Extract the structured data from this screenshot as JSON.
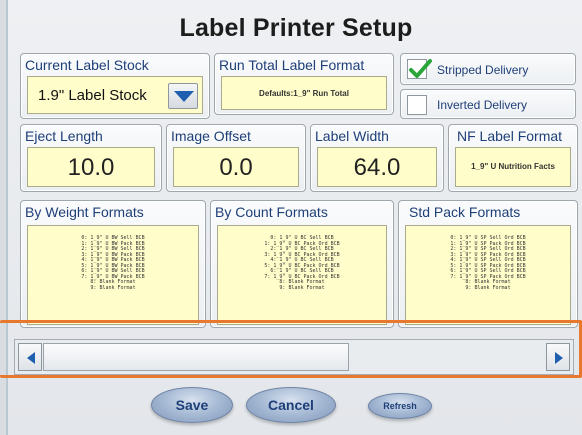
{
  "title": "Label Printer Setup",
  "current_label_stock": {
    "title": "Current Label Stock",
    "value": "1.9\" Label Stock"
  },
  "run_total": {
    "title": "Run Total Label Format",
    "value": "Defaults:1_9\" Run Total"
  },
  "options": {
    "stripped": {
      "label": "Stripped Delivery",
      "checked": true
    },
    "inverted": {
      "label": "Inverted Delivery",
      "checked": false
    }
  },
  "eject_length": {
    "title": "Eject Length",
    "value": "10.0"
  },
  "image_offset": {
    "title": "Image Offset",
    "value": "0.0"
  },
  "label_width": {
    "title": "Label Width",
    "value": "64.0"
  },
  "nf_label_format": {
    "title": "NF Label Format",
    "value": "1_9\" U Nutrition Facts"
  },
  "by_weight": {
    "title": "By Weight Formats",
    "items": "0: 1_9\" U BW Sell BCB\n1: 1_9\" U BW Pack BCB\n2: 1_9\" U BW Sell BCB\n3: 1_9\" U BW Pack BCB\n4: 1_9\" U BW Pack BCB\n5: 1_9\" U BW Pack BCB\n6: 1_9\" U BW Sell BCB\n7: 1_9\" U BW Pack BCB\n8: Blank Format\n9: Blank Format"
  },
  "by_count": {
    "title": "By Count Formats",
    "items": "0: 1_9\" U BC Sell BCB\n1: 1_9\" U BC Pack Ord BCB\n2: 1_9\" U BC Sell BCB\n3: 1_9\" U BC Pack Ord BCB\n4: 1_9\" U BC Sell BCB\n5: 1_9\" U BC Pack Ord BCB\n6: 1_9\" U BC Sell BCB\n7: 1_9\" U BC Pack Ord BCB\n8: Blank Format\n9: Blank Format"
  },
  "std_pack": {
    "title": "Std Pack Formats",
    "items": "0: 1_9\" U SP Sell Ord BCB\n1: 1_9\" U SP Pack Ord BCB\n2: 1_9\" U SP Sell Ord BCB\n3: 1_9\" U SP Pack Ord BCB\n4: 1_9\" U SP Sell Ord BCB\n5: 1_9\" U SP Pack Ord BCB\n6: 1_9\" U SP Sell Ord BCB\n7: 1_9\" U SP Pack Ord BCB\n8: Blank Format\n9: Blank Format"
  },
  "scrollbar": {
    "position": 0.0
  },
  "buttons": {
    "save": "Save",
    "cancel": "Cancel",
    "refresh": "Refresh"
  },
  "colors": {
    "accent_blue": "#1e3f78",
    "field_yellow": "#fffdc9",
    "highlight_orange": "#e8782e",
    "check_green": "#2aa53a"
  },
  "icons": {
    "dropdown": "chevron-down-icon",
    "scroll_left": "arrow-left-icon",
    "scroll_right": "arrow-right-icon",
    "check": "checkmark-icon"
  }
}
